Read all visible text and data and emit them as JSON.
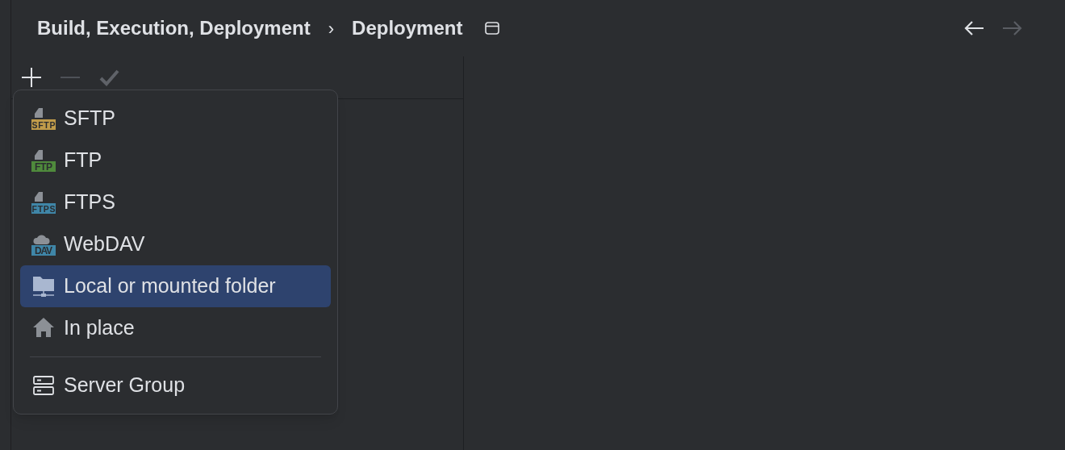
{
  "breadcrumb": [
    {
      "label": "Build, Execution, Deployment"
    },
    {
      "label": "Deployment"
    }
  ],
  "breadcrumb_separator": "›",
  "nav": [
    {
      "kind": "back",
      "disabled": false
    },
    {
      "kind": "forward",
      "disabled": true
    }
  ],
  "toolbar": [
    {
      "kind": "add",
      "disabled": false
    },
    {
      "kind": "remove",
      "disabled": true
    },
    {
      "kind": "apply",
      "disabled": true
    }
  ],
  "menu": {
    "groups": [
      [
        {
          "kind": "file",
          "badge": "SFTP",
          "color": "#c09b4a",
          "label": "SFTP",
          "selected": false
        },
        {
          "kind": "file",
          "badge": "FTP",
          "color": "#4f8a3c",
          "label": "FTP",
          "selected": false
        },
        {
          "kind": "file",
          "badge": "FTPS",
          "color": "#3f86a8",
          "label": "FTPS",
          "selected": false
        },
        {
          "kind": "cloud",
          "badge": "DAV",
          "color": "#3f86a8",
          "label": "WebDAV",
          "selected": false
        },
        {
          "kind": "folder",
          "label": "Local or mounted folder",
          "selected": true
        },
        {
          "kind": "home",
          "label": "In place",
          "selected": false
        }
      ],
      [
        {
          "kind": "servers",
          "label": "Server Group",
          "selected": false
        }
      ]
    ]
  }
}
